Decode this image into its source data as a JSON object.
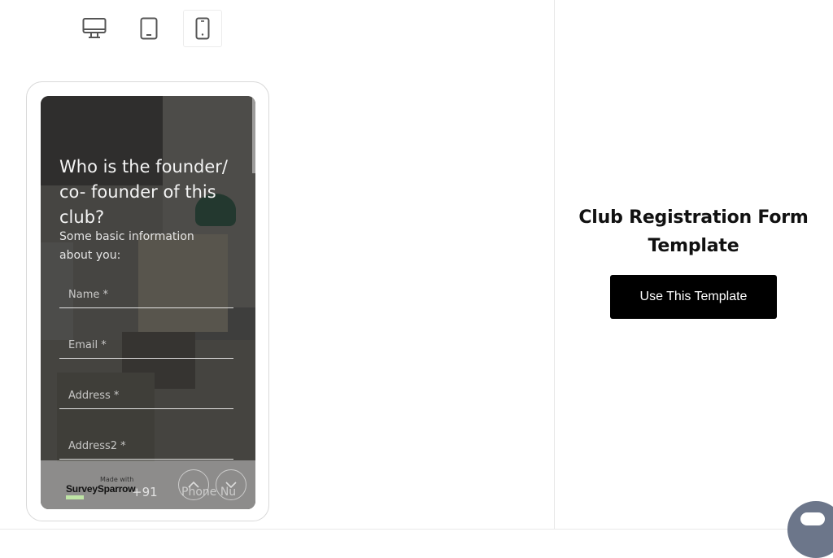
{
  "device_switcher": {
    "items": [
      {
        "name": "desktop",
        "icon": "desktop-icon"
      },
      {
        "name": "tablet",
        "icon": "tablet-icon"
      },
      {
        "name": "mobile",
        "icon": "mobile-icon"
      }
    ],
    "active": "mobile"
  },
  "preview": {
    "question": "Who is the founder/ co- founder of this club?",
    "subtitle": "Some basic information about you:",
    "fields": {
      "name_placeholder": "Name *",
      "email_placeholder": "Email *",
      "address_placeholder": "Address *",
      "address2_placeholder": "Address2 *"
    },
    "phone_code": "+91",
    "phone_placeholder": "Phone Nu",
    "footer": {
      "made_with": "Made with",
      "brand": "SurveySparrow",
      "up_icon": "chevron-up-icon",
      "down_icon": "chevron-down-icon"
    }
  },
  "template": {
    "title": "Club Registration Form Template",
    "cta_label": "Use This Template"
  },
  "chat": {
    "icon": "chat-icon"
  }
}
